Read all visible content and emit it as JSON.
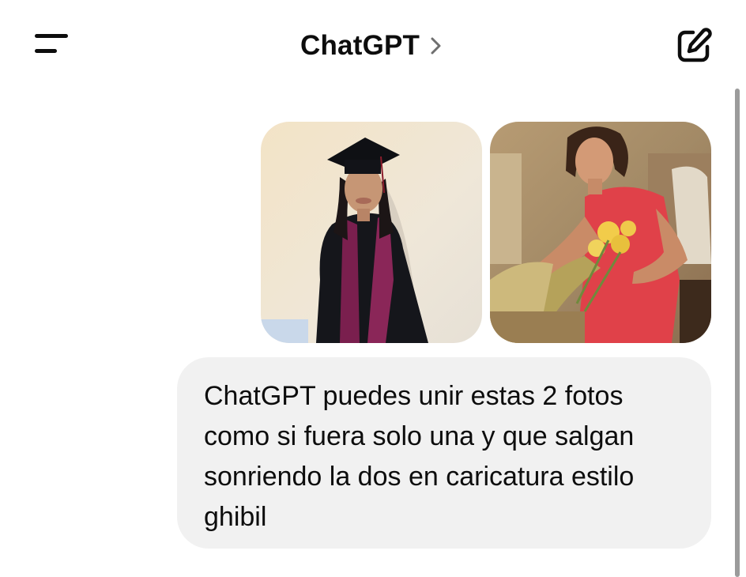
{
  "header": {
    "title": "ChatGPT",
    "icons": {
      "menu": "menu-icon",
      "chevron": "chevron-right-icon",
      "compose": "compose-icon"
    }
  },
  "conversation": {
    "attachments": [
      {
        "type": "image",
        "description_icon": "photo-graduate"
      },
      {
        "type": "image",
        "description_icon": "photo-woman-flowers"
      }
    ],
    "user_message": "ChatGPT puedes unir estas 2 fotos como si fuera solo una y que salgan sonriendo la dos en caricatura estilo ghibil"
  },
  "colors": {
    "text": "#0d0d0d",
    "bubble": "#f1f1f1",
    "background": "#ffffff"
  }
}
